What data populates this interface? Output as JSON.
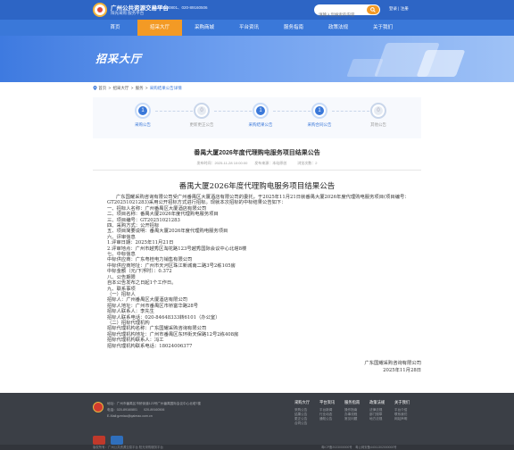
{
  "header": {
    "site_title": "广州公共资源交易平台",
    "site_subtitle": "阳光采购 服务平台",
    "phones": "020-89160801、020-89160506",
    "search_placeholder": "请输入您搜索的内容",
    "login": "登录",
    "separator": "|",
    "register": "注册"
  },
  "nav": {
    "items": [
      "首页",
      "招采大厅",
      "采购商城",
      "平台资讯",
      "服务指南",
      "政策法规",
      "关于我们"
    ],
    "active_index": 1
  },
  "banner": {
    "title": "招采大厅"
  },
  "breadcrumb": {
    "home": "首页",
    "sep": ">",
    "level1": "招采大厅",
    "level2": "服务",
    "current": "采购结果公告详情"
  },
  "steps": [
    {
      "num": "1",
      "label": "采购公告",
      "active": true
    },
    {
      "num": "0",
      "label": "更新更正公告",
      "active": false
    },
    {
      "num": "1",
      "label": "采购结果公告",
      "active": true
    },
    {
      "num": "1",
      "label": "采购合同公告",
      "active": true
    },
    {
      "num": "0",
      "label": "其他公告",
      "active": false
    }
  ],
  "article": {
    "title": "番禺大厦2026年度代理购电服务项目结果公告",
    "meta": "发布时间：2025-11-28 10:00:00　　发布来源：本站原创　　　浏览次数：2",
    "doc_title": "番禺大厦2026年度代理购电服务项目结果公告",
    "paragraphs": [
      "广东国耀采购咨询有限公司受广州番禺区大厦酒店有限公司的委托，于2025年11月21日就番禺大厦2026年度代理购电服务项目(项目编号：GT20251021283)采用公开招标方式进行招标。现就本次招标的中标结果公告如下："
    ],
    "lines": [
      "一、招标人名称：广州番禺区大厦酒店有限公司",
      "二、项目名称：番禺大厦2026年度代理购电服务项目",
      "三、项目编号：GT20251021283",
      "四、采购方式：公开招标",
      "五、项目简要说明：番禺大厦2026年度代理购电服务项目",
      "六、评审信息",
      "1.评审日期：2025年11月21日",
      "2.评审地点：广州市越秀区淘花路123号越秀国际会议中心北塔8楼",
      "七、中标信息",
      "中标供应商：广东粤桂电力销售有限公司",
      "中标供应商地址：广州市天河区珠江新城南二路3号2栋105房",
      "中标金额（元/下浮时）：0.372",
      "八、公告期限",
      "自本公告发布之日起1个工作日。",
      "九、联系事项",
      "（一）招标人",
      "招标人：广州番禺区大厦酒店有限公司",
      "招标人地址：广州市番禺区市桥富华路28号",
      "招标人联系人：李先生",
      "招标人联系电话：020-84648333转6101（办公室）",
      "（二）招标代理机构",
      "招标代理机构名称：广东国耀采购咨询有限公司",
      "招标代理机构地址：广州市番禺区东环街天保路12号2栋408房",
      "招标代理机构联系人：冯工",
      "招标代理机构联系电话：18024006377"
    ],
    "signature": "广东国耀采购咨询有限公司",
    "date": "2025年11月28日"
  },
  "footer": {
    "lines": [
      "地址：广州市番禺区市桥街道123号广州番禺国际会议中心北塔7楼",
      "电话：020-89160801　　020-89160506",
      "E-Mail:gzmiao@qaimao.com.cn"
    ],
    "columns": [
      {
        "title": "采购大厅",
        "items": [
          "采购公告",
          "结果公告",
          "更正公告",
          "合同公告"
        ]
      },
      {
        "title": "平台资讯",
        "items": [
          "平台新闻",
          "行业动态",
          "通知公告"
        ]
      },
      {
        "title": "服务指南",
        "items": [
          "操作指南",
          "办事流程",
          "常见问题"
        ]
      },
      {
        "title": "政策法规",
        "items": [
          "法律法规",
          "部门规章",
          "地方法规"
        ]
      },
      {
        "title": "关于我们",
        "items": [
          "平台介绍",
          "联系我们",
          "网站声明"
        ]
      }
    ],
    "copyright": "版权所有：广州公共资源交易平台 阳光采购服务平台",
    "icp": "粤ICP备2023000000号　粤公网安备44011302000000号"
  }
}
